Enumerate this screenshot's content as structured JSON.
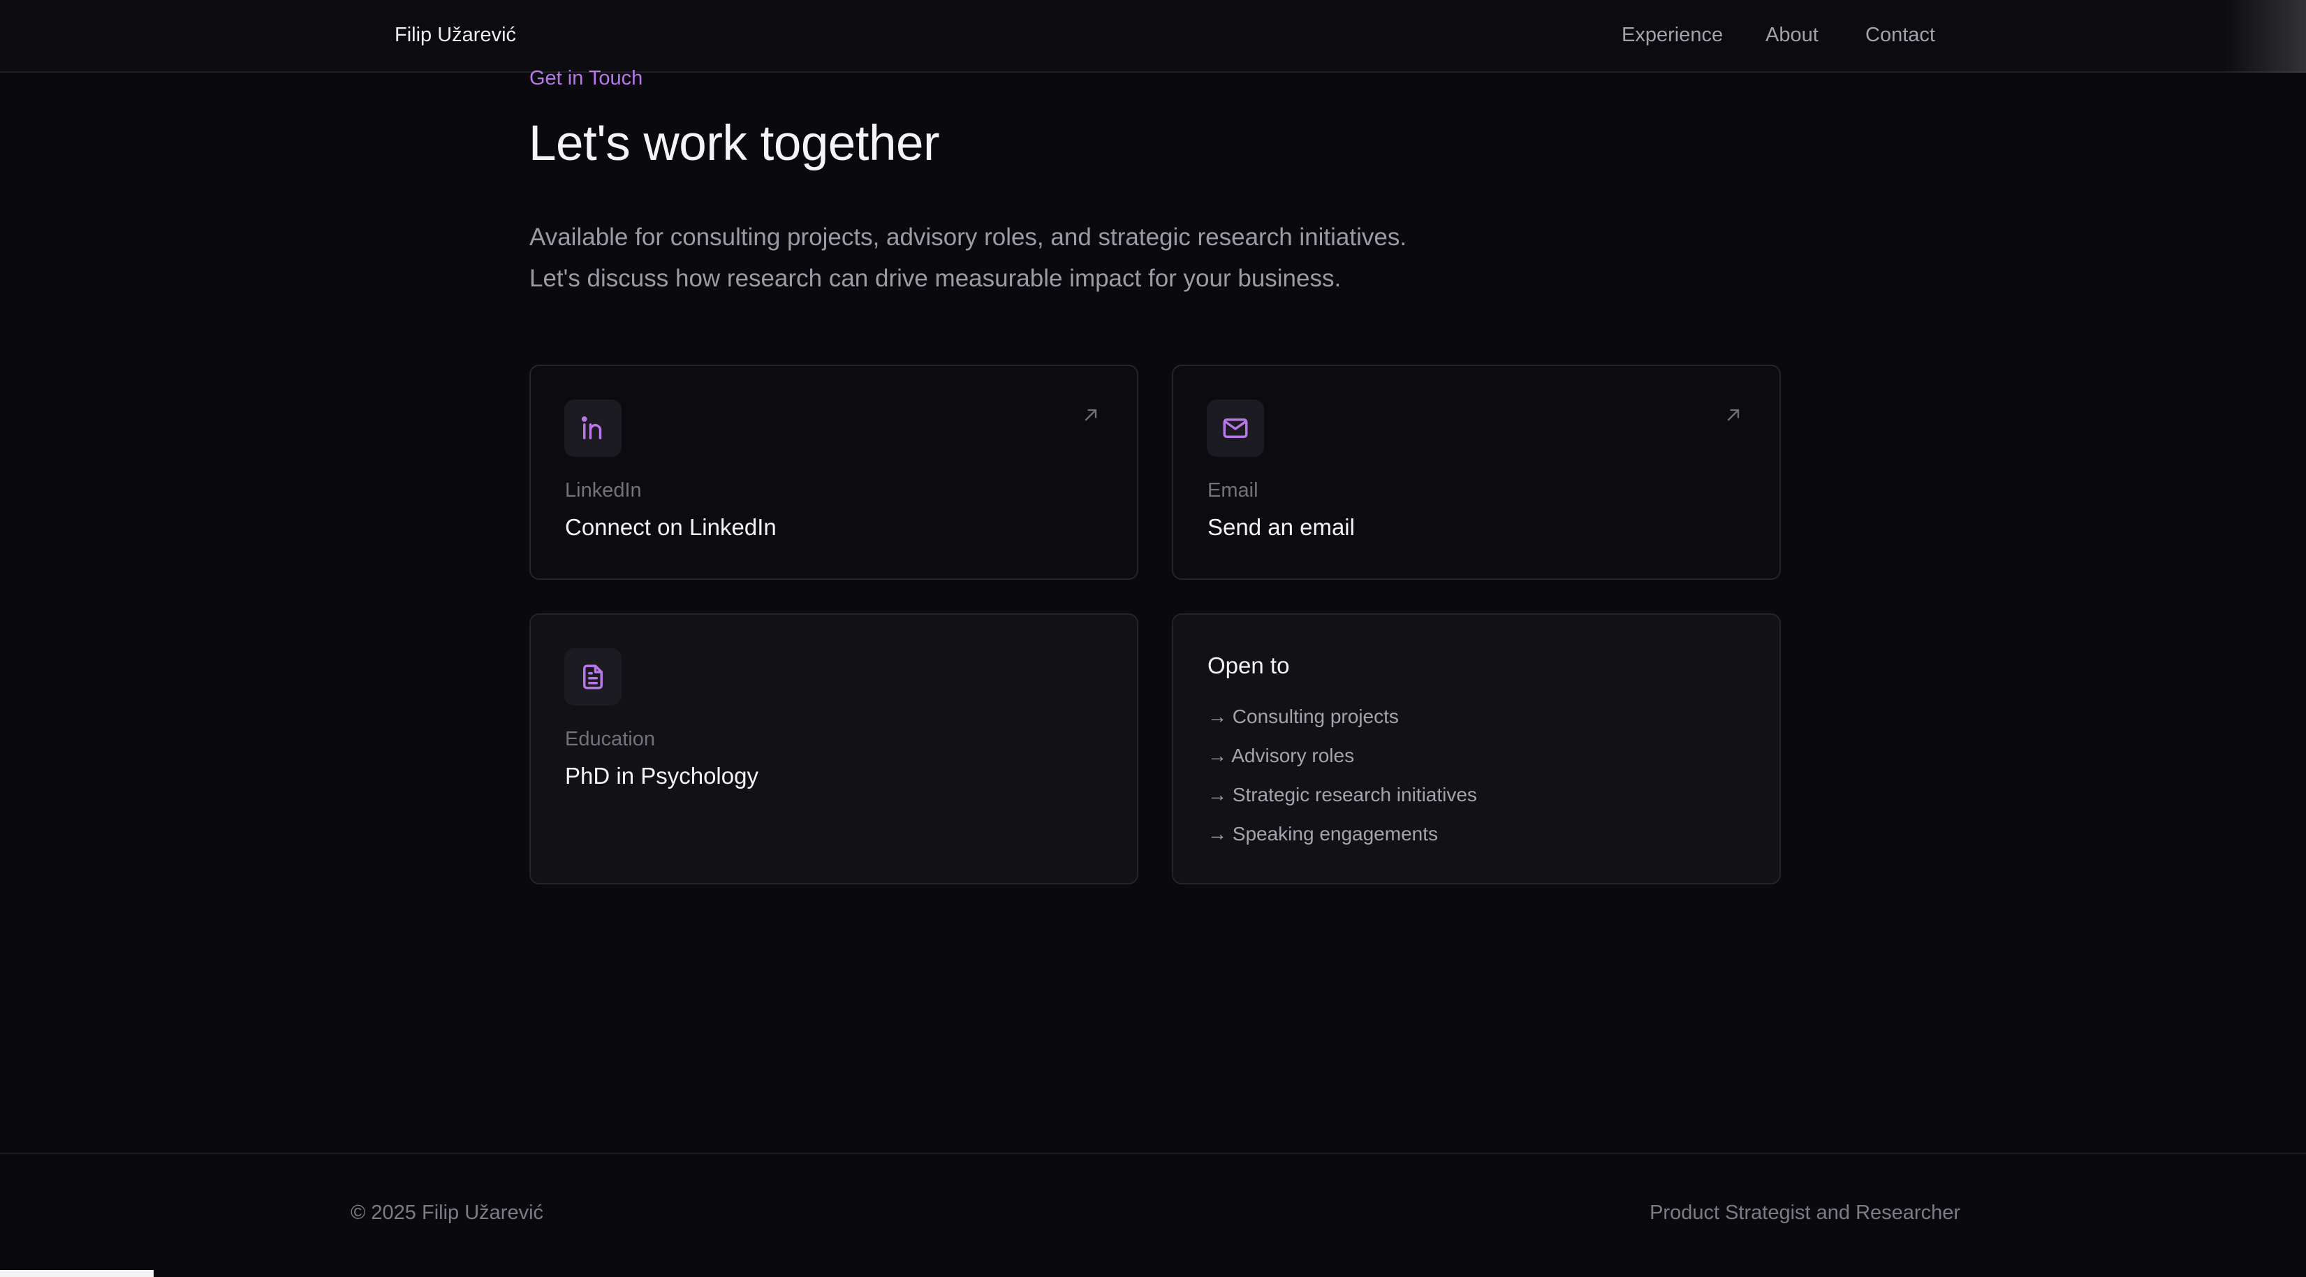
{
  "header": {
    "brand": "Filip Užarević",
    "nav": [
      "Experience",
      "About",
      "Contact"
    ]
  },
  "hero": {
    "eyebrow": "Get in Touch",
    "title": "Let's work together",
    "intro_lines": [
      "Available for consulting projects, advisory roles, and strategic research initiatives.",
      "Let's discuss how research can drive measurable impact for your business."
    ]
  },
  "cards": {
    "linkedin": {
      "label": "LinkedIn",
      "value": "Connect on LinkedIn",
      "icon": "linkedin-icon"
    },
    "email": {
      "label": "Email",
      "value": "Send an email",
      "icon": "mail-icon"
    },
    "education": {
      "label": "Education",
      "value": "PhD in Psychology",
      "icon": "document-icon"
    },
    "open_to": {
      "title": "Open to",
      "items": [
        "→ Consulting projects",
        "→ Advisory roles",
        "→ Strategic research initiatives",
        "→ Speaking engagements"
      ]
    }
  },
  "footer": {
    "copyright": "© 2025 Filip Užarević",
    "role": "Product Strategist and Researcher"
  },
  "colors": {
    "background": "#0a0a0e",
    "accent": "#b877e8",
    "card_border": "#24242b",
    "muted_text": "#9b9ba4"
  }
}
